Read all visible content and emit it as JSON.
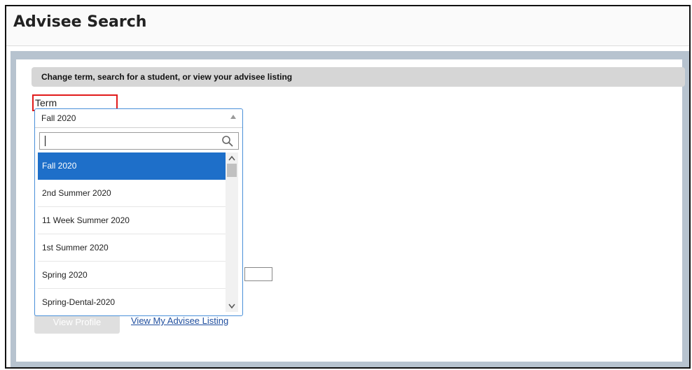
{
  "page": {
    "title": "Advisee Search"
  },
  "section": {
    "header": "Change term, search for a student, or view your advisee listing"
  },
  "term": {
    "label": "Term",
    "selected": "Fall 2020",
    "search_value": "",
    "options": [
      "Fall 2020",
      "2nd Summer 2020",
      "11 Week Summer 2020",
      "1st Summer 2020",
      "Spring 2020",
      "Spring-Dental-2020"
    ]
  },
  "actions": {
    "view_profile": "View Profile",
    "view_advisee_listing": "View My Advisee Listing"
  },
  "icons": {
    "dropdown": "chevron-up-icon",
    "search": "search-icon",
    "scroll_up": "scroll-up-icon",
    "scroll_down": "scroll-down-icon"
  },
  "colors": {
    "accent": "#1e6fc9",
    "panel": "#b7c3cf",
    "highlight": "#e11b1b",
    "link": "#1f4e9e"
  }
}
